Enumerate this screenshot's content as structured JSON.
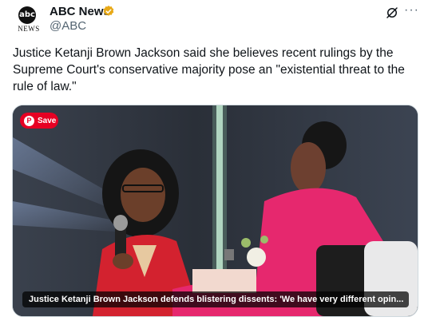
{
  "account": {
    "name": "ABC News",
    "handle": "@ABC",
    "logo_text": "abc",
    "logo_subtext": "NEWS",
    "verified_color": "#e8a917"
  },
  "tweet": {
    "text": "Justice Ketanji Brown Jackson said she believes recent rulings by the Supreme Court's conservative majority pose an \"existential threat to the rule of law.\""
  },
  "media": {
    "save_label": "Save",
    "caption": "Justice Ketanji Brown Jackson defends blistering dissents: 'We have very different opin..."
  },
  "icons": {
    "grok": "grok-icon",
    "more": "more-icon",
    "verified": "verified-badge-icon",
    "pinterest": "pinterest-icon"
  }
}
